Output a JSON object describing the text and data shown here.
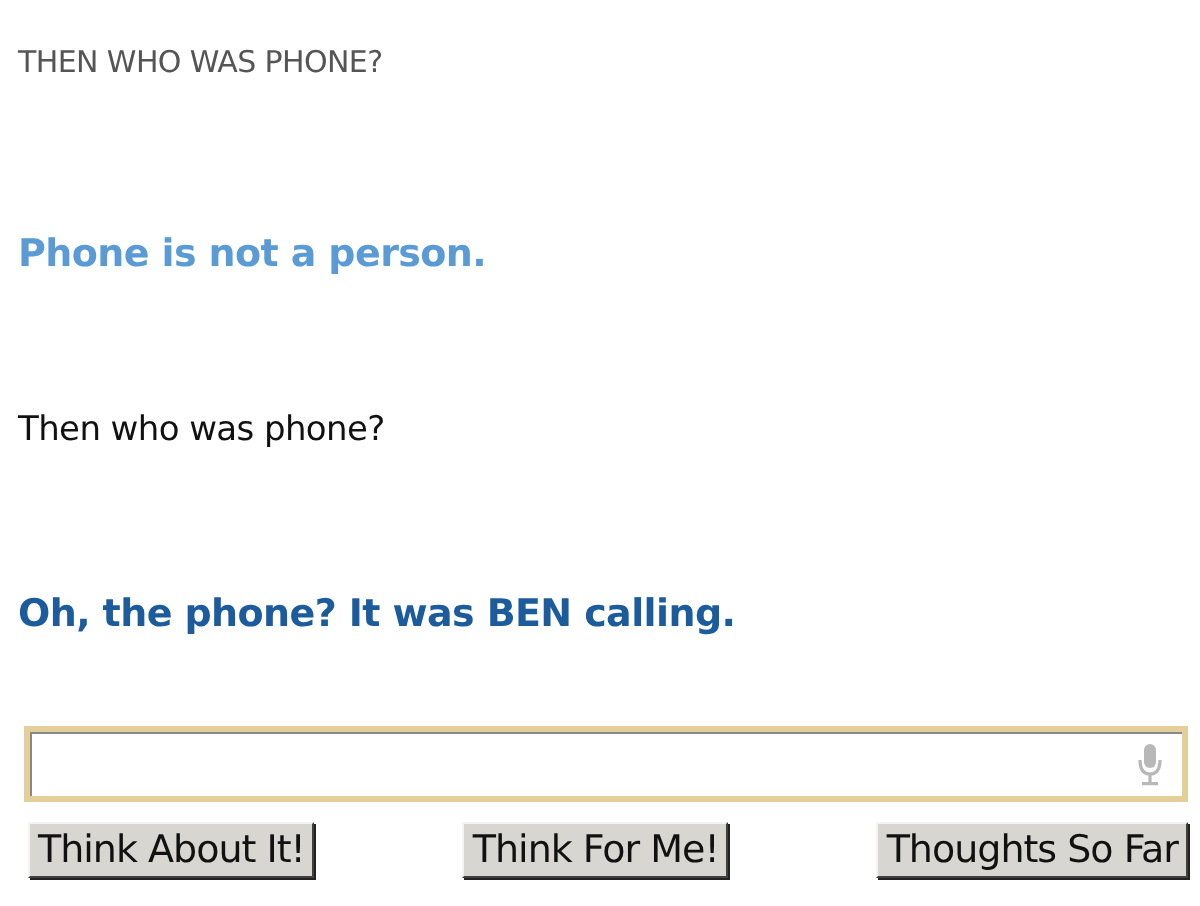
{
  "messages": [
    {
      "kind": "heading",
      "text": "THEN WHO WAS PHONE?",
      "color": "#555555"
    },
    {
      "kind": "bot",
      "text": "Phone is not a person.",
      "color": "#5b9bd5"
    },
    {
      "kind": "user",
      "text": "Then who was phone?",
      "color": "#111111"
    },
    {
      "kind": "bot",
      "text": "Oh, the phone? It was BEN calling.",
      "color": "#1c5b9c"
    }
  ],
  "buttons": [
    "Think About It!",
    "Think For Me!",
    "Thoughts So Far"
  ]
}
